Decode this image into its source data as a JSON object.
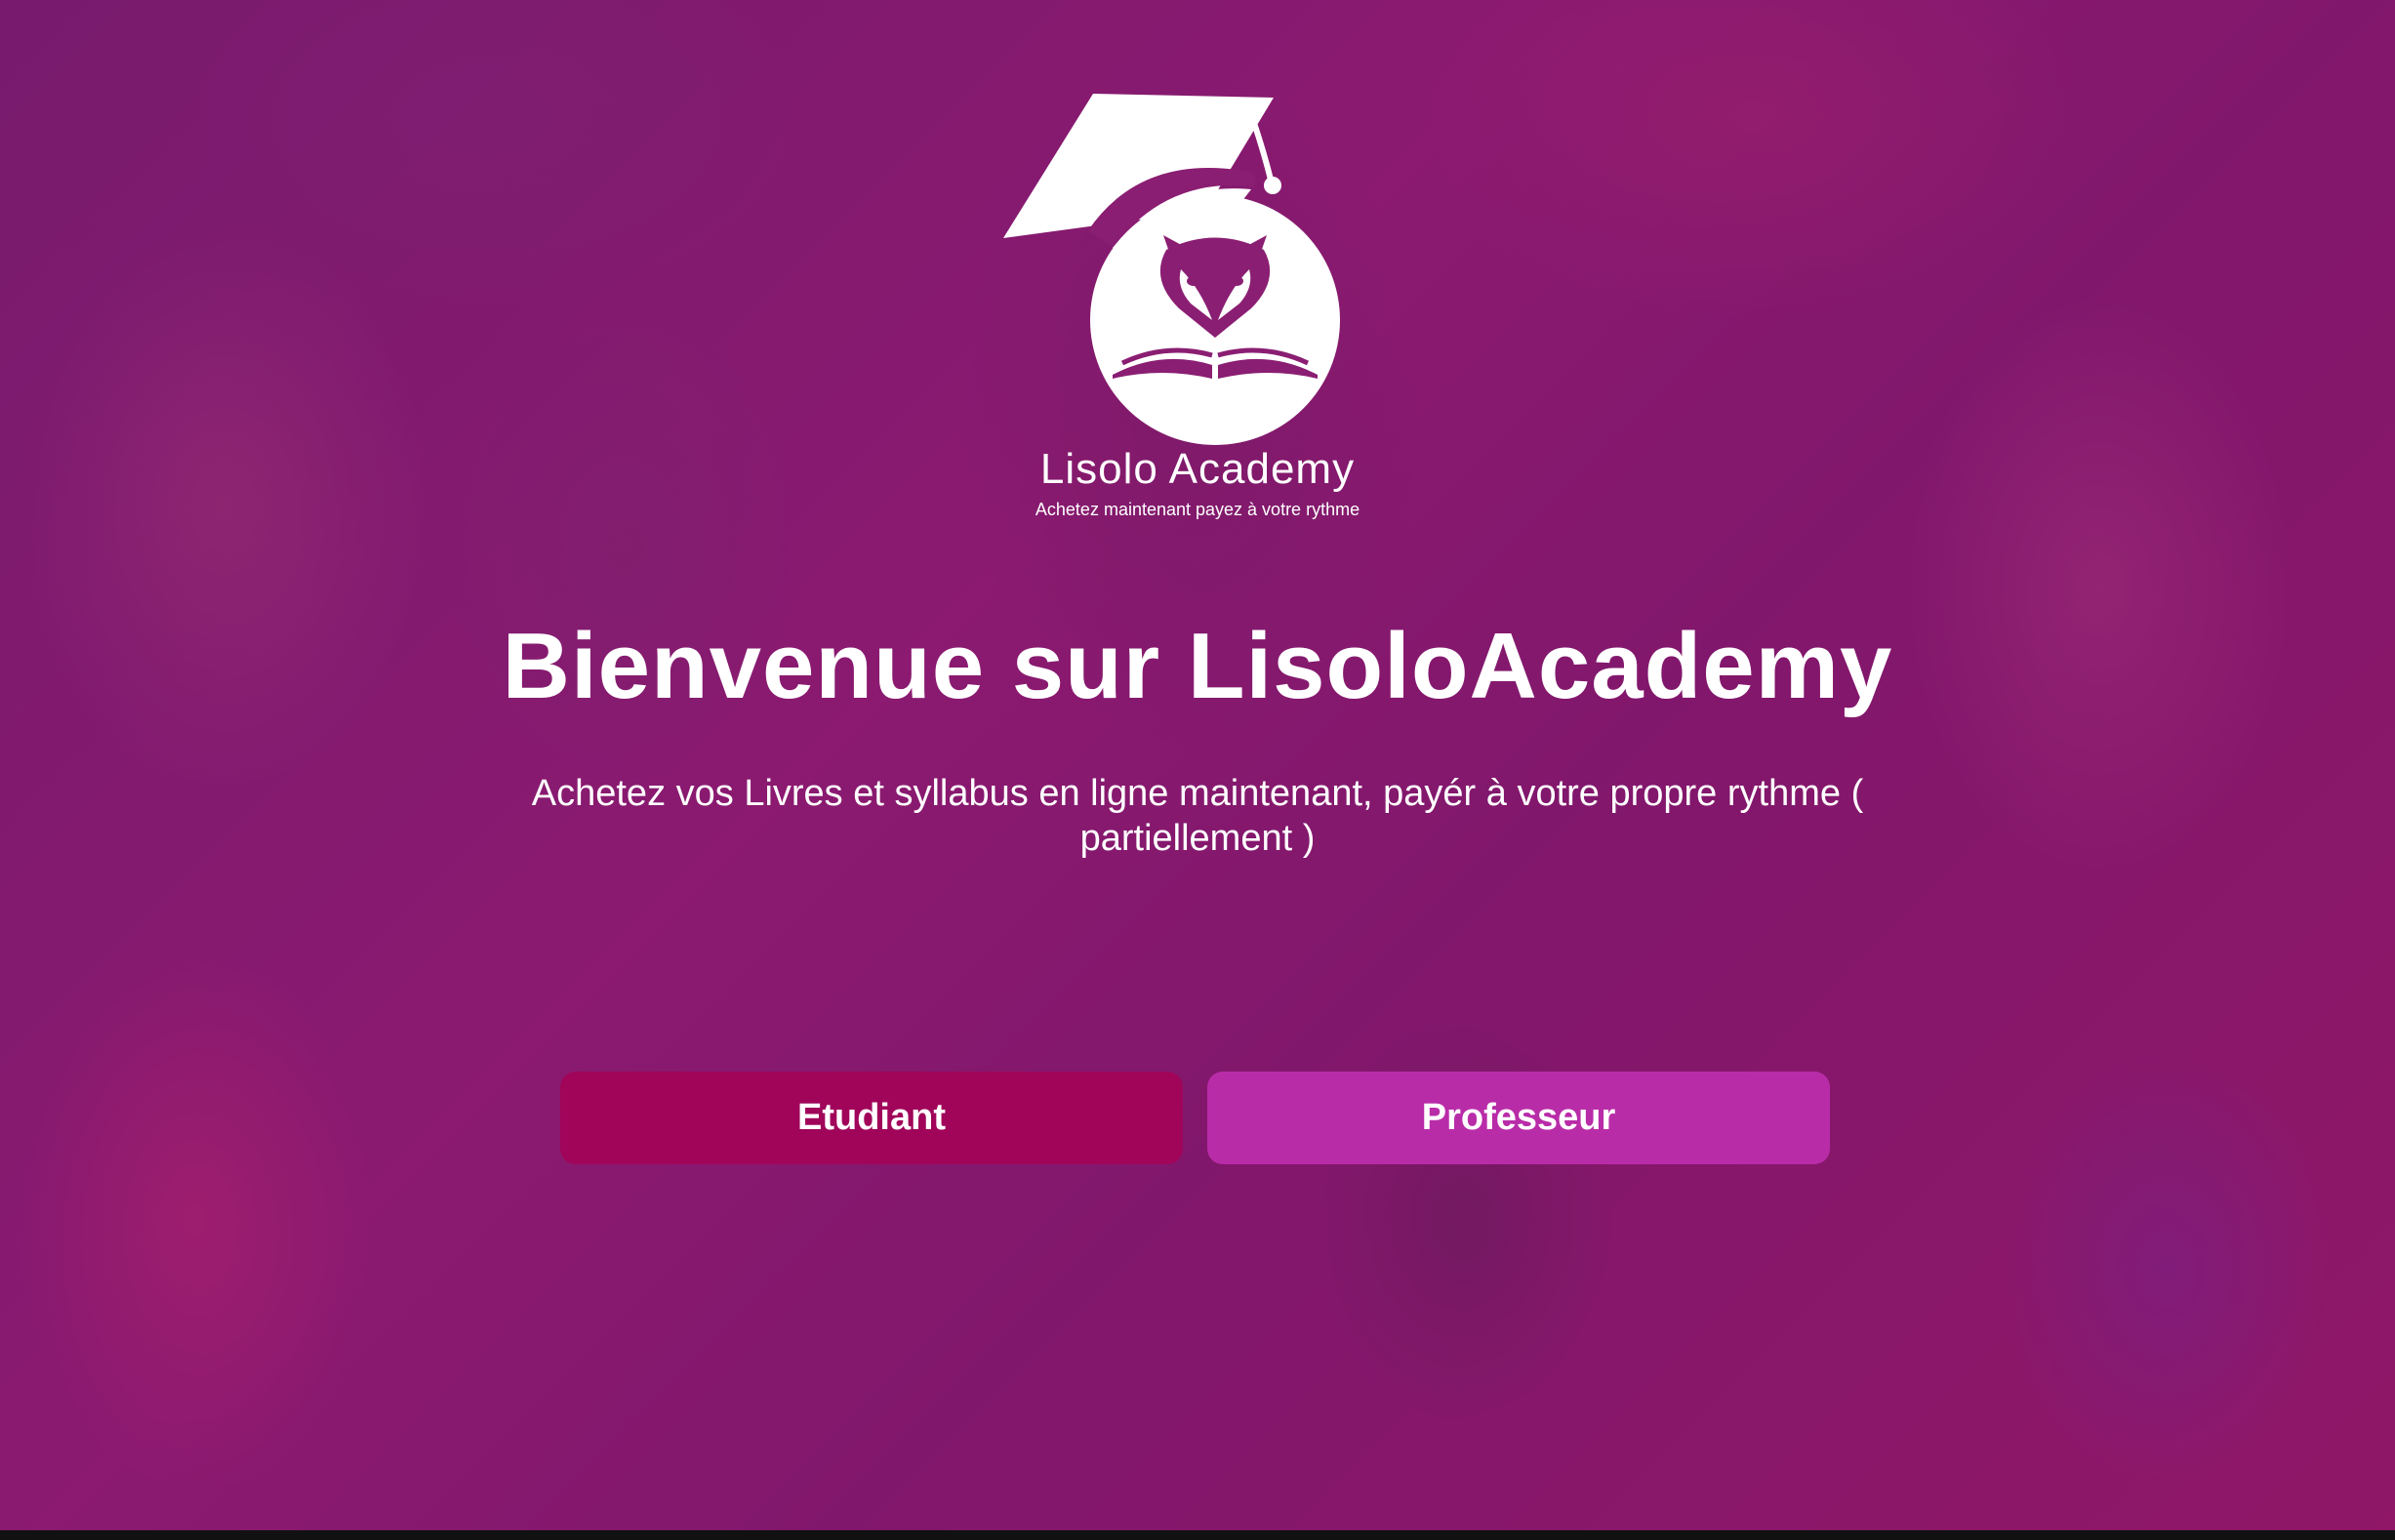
{
  "colors": {
    "student_button": "#a0055a",
    "teacher_button": "#b92ca8",
    "text": "#ffffff"
  },
  "brand": {
    "name": "Lisolo Academy",
    "tagline": "Achetez maintenant payez à votre rythme",
    "logo_icon": "graduation-cap-fox-book-icon"
  },
  "hero": {
    "title": "Bienvenue sur LisoloAcademy",
    "subtitle": "Achetez vos Livres et syllabus en ligne maintenant, payér à votre propre rythme ( partiellement )"
  },
  "actions": {
    "student_label": "Etudiant",
    "teacher_label": "Professeur"
  }
}
